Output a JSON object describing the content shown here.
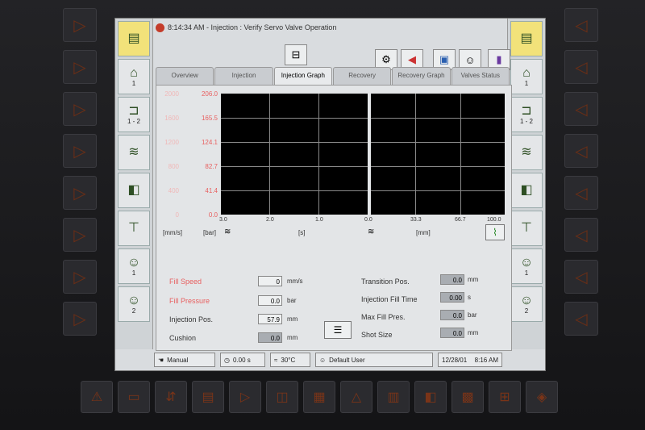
{
  "title": "8:14:34 AM - Injection : Verify Servo Valve Operation",
  "left_sidebar": [
    {
      "label": "",
      "icon": "file-cabinet-icon"
    },
    {
      "label": "1",
      "icon": "machine-icon"
    },
    {
      "label": "1 - 2",
      "icon": "clamp-icon"
    },
    {
      "label": "",
      "icon": "screw-icon"
    },
    {
      "label": "",
      "icon": "mold-icon"
    },
    {
      "label": "",
      "icon": "nozzle-icon"
    },
    {
      "label": "1",
      "icon": "operator-icon"
    },
    {
      "label": "2",
      "icon": "operator-icon"
    }
  ],
  "right_sidebar": [
    {
      "label": "",
      "icon": "file-cabinet-icon"
    },
    {
      "label": "1",
      "icon": "machine-icon"
    },
    {
      "label": "1 - 2",
      "icon": "clamp-icon"
    },
    {
      "label": "",
      "icon": "screw-icon"
    },
    {
      "label": "",
      "icon": "mold-icon"
    },
    {
      "label": "",
      "icon": "nozzle-icon"
    },
    {
      "label": "1",
      "icon": "operator-icon"
    },
    {
      "label": "2",
      "icon": "operator-icon"
    }
  ],
  "tabs": [
    {
      "label": "Overview",
      "active": false
    },
    {
      "label": "Injection",
      "active": false
    },
    {
      "label": "Injection Graph",
      "active": true
    },
    {
      "label": "Recovery",
      "active": false
    },
    {
      "label": "Recovery Graph",
      "active": false
    },
    {
      "label": "Valves Status",
      "active": false
    }
  ],
  "graph": {
    "y_left_labels": [
      "2000",
      "1600",
      "1200",
      "800",
      "400",
      "0"
    ],
    "y_right_labels": [
      "206.0",
      "165.5",
      "124.1",
      "82.7",
      "41.4",
      "0.0"
    ],
    "x_time_labels": [
      "3.0",
      "2.0",
      "1.0",
      "0.0"
    ],
    "x_pos_labels": [
      "33.3",
      "66.7",
      "100.0"
    ],
    "unit_speed": "[mm/s]",
    "unit_pressure": "[bar]",
    "unit_time": "[s]",
    "unit_position": "[mm]"
  },
  "fields_left": [
    {
      "label": "Fill Speed",
      "value": "0",
      "unit": "mm/s",
      "label_color": "#e86060",
      "shaded": false
    },
    {
      "label": "Fill Pressure",
      "value": "0.0",
      "unit": "bar",
      "label_color": "#e86060",
      "shaded": false
    },
    {
      "label": "Injection Pos.",
      "value": "57.9",
      "unit": "mm",
      "label_color": "#333333",
      "shaded": false
    },
    {
      "label": "Cushion",
      "value": "0.0",
      "unit": "mm",
      "label_color": "#333333",
      "shaded": true
    }
  ],
  "fields_right": [
    {
      "label": "Transition Pos.",
      "value": "0.0",
      "unit": "mm"
    },
    {
      "label": "Injection Fill Time",
      "value": "0.00",
      "unit": "s"
    },
    {
      "label": "Max Fill Pres.",
      "value": "0.0",
      "unit": "bar"
    },
    {
      "label": "Shot Size",
      "value": "0.0",
      "unit": "mm"
    }
  ],
  "status": {
    "mode": "Manual",
    "timer": "0.00 s",
    "temp": "30°C",
    "user": "Default User",
    "date": "12/28/01",
    "time": "8:16 AM"
  },
  "colors": {
    "graph_bg": "#000000",
    "grid": "#8a8a8a",
    "warning_red": "#e86060"
  }
}
